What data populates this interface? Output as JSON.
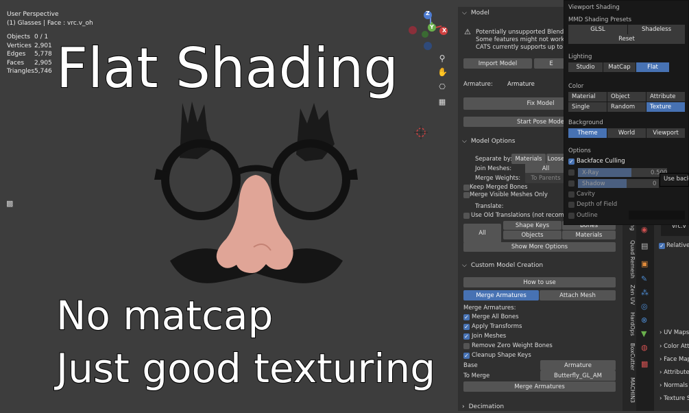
{
  "viewport": {
    "perspective": "User Perspective",
    "object": "(1) Glasses | Face : vrc.v_oh",
    "stats": [
      {
        "label": "Objects",
        "value": "0 / 1"
      },
      {
        "label": "Vertices",
        "value": "2,901"
      },
      {
        "label": "Edges",
        "value": "5,778"
      },
      {
        "label": "Faces",
        "value": "2,905"
      },
      {
        "label": "Triangles",
        "value": "5,746"
      }
    ],
    "gizmo": {
      "z": "Z",
      "y": "Y",
      "x": "X"
    }
  },
  "overlay": {
    "title": "Flat Shading",
    "line1": "No matcap",
    "line2": "Just good texturing"
  },
  "panel": {
    "model_header": "Model",
    "warning": [
      "Potentially unsupported Blender ver",
      "Some features might not work!",
      "CATS currently supports up to Blend"
    ],
    "import_model": "Import Model",
    "export_short": "E",
    "armature_label": "Armature:",
    "armature_value": "Armature",
    "fix_model": "Fix Model",
    "start_pose": "Start Pose Mode",
    "model_options": "Model Options",
    "separate_by": "Separate by:",
    "materials": "Materials",
    "loose": "Loose",
    "join_meshes": "Join Meshes:",
    "all": "All",
    "merge_weights": "Merge Weights:",
    "to_parents": "To Parents",
    "keep_merged": "Keep Merged Bones",
    "merge_visible": "Merge Visible Meshes Only",
    "translate": "Translate:",
    "old_trans": "Use Old Translations (not recommende",
    "shape_keys": "Shape Keys",
    "bones": "Bones",
    "all2": "All",
    "objects": "Objects",
    "materials2": "Materials",
    "show_more": "Show More Options",
    "custom_header": "Custom Model Creation",
    "how_to": "How to use",
    "merge_arm_tab": "Merge Armatures",
    "attach_mesh_tab": "Attach Mesh",
    "merge_arm_label": "Merge Armatures:",
    "checks": [
      "Merge All Bones",
      "Apply Transforms",
      "Join Meshes",
      "Remove Zero Weight Bones",
      "Cleanup Shape Keys"
    ],
    "checks_on": [
      true,
      true,
      true,
      false,
      true
    ],
    "base": "Base",
    "base_value": "Armature",
    "to_merge": "To Merge",
    "to_merge_value": "Butterfly_GL_AM",
    "merge_btn": "Merge Armatures",
    "decimation": "Decimation"
  },
  "tabs": [
    "Quad Remesh",
    "Zen UV",
    "HardOps",
    "BoxCutter",
    "MACHIN3"
  ],
  "tab_partial": "ng",
  "properties": {
    "vrc": "vrc.v",
    "relative": "Relative",
    "sections": [
      "UV Maps",
      "Color Attr",
      "Face Maps",
      "Attributes",
      "Normals",
      "Texture S"
    ]
  },
  "shading": {
    "title": "Viewport Shading",
    "presets_label": "MMD Shading Presets",
    "glsl": "GLSL",
    "shadeless": "Shadeless",
    "reset": "Reset",
    "lighting_label": "Lighting",
    "lighting": [
      "Studio",
      "MatCap",
      "Flat"
    ],
    "color_label": "Color",
    "color_row1": [
      "Material",
      "Object",
      "Attribute"
    ],
    "color_row2": [
      "Single",
      "Random",
      "Texture"
    ],
    "background_label": "Background",
    "background": [
      "Theme",
      "World",
      "Viewport"
    ],
    "options_label": "Options",
    "backface": "Backface Culling",
    "xray": "X-Ray",
    "xray_value": "0.500",
    "shadow": "Shadow",
    "shadow_value": "0",
    "tooltip": "Use back",
    "cavity": "Cavity",
    "dof": "Depth of Field",
    "outline": "Outline"
  },
  "colors": {
    "accent": "#4772b3",
    "bg": "#3d3d3d",
    "panel": "#303030"
  }
}
